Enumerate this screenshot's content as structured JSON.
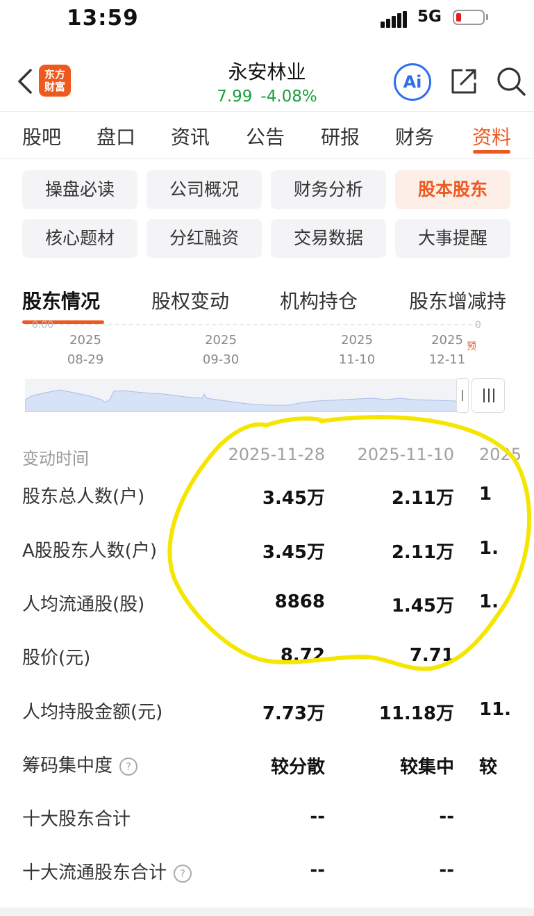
{
  "status_bar": {
    "time": "13:59",
    "network": "5G"
  },
  "header": {
    "logo_line1": "东方",
    "logo_line2": "财富",
    "title": "永安林业",
    "price": "7.99",
    "change_pct": "-4.08%",
    "ai_label": "Ai",
    "colors": {
      "accent": "#ec5a24",
      "down": "#1a9e3c",
      "ai": "#2d6df0"
    }
  },
  "main_tabs": [
    "股吧",
    "盘口",
    "资讯",
    "公告",
    "研报",
    "财务",
    "资料"
  ],
  "sub_grid": [
    "操盘必读",
    "公司概况",
    "财务分析",
    "股本股东",
    "核心题材",
    "分红融资",
    "交易数据",
    "大事提醒"
  ],
  "sub_tabs": [
    "股东情况",
    "股权变动",
    "机构持仓",
    "股东增减持"
  ],
  "chart": {
    "cut_label_left": "0.00",
    "cut_label_right": "0",
    "x_labels": [
      {
        "year": "2025",
        "date": "08-29"
      },
      {
        "year": "2025",
        "date": "09-30"
      },
      {
        "year": "2025",
        "date": "11-10"
      },
      {
        "year": "2025",
        "date": "12-11"
      }
    ],
    "forecast_label": "预"
  },
  "table": {
    "header_label": "变动时间",
    "columns": [
      "2025-11-28",
      "2025-11-10",
      "2025"
    ],
    "rows": [
      {
        "label": "股东总人数(户)",
        "values": [
          "3.45万",
          "2.11万",
          "1"
        ]
      },
      {
        "label": "A股股东人数(户)",
        "values": [
          "3.45万",
          "2.11万",
          "1."
        ]
      },
      {
        "label": "人均流通股(股)",
        "values": [
          "8868",
          "1.45万",
          "1."
        ]
      },
      {
        "label": "股价(元)",
        "values": [
          "8.72",
          "7.71",
          ""
        ]
      },
      {
        "label": "人均持股金额(元)",
        "values": [
          "7.73万",
          "11.18万",
          "11."
        ]
      },
      {
        "label": "筹码集中度",
        "values": [
          "较分散",
          "较集中",
          "较"
        ],
        "help": "?"
      },
      {
        "label": "十大股东合计",
        "values": [
          "--",
          "--",
          ""
        ]
      },
      {
        "label": "十大流通股东合计",
        "values": [
          "--",
          "--",
          ""
        ],
        "help": "?"
      }
    ]
  }
}
